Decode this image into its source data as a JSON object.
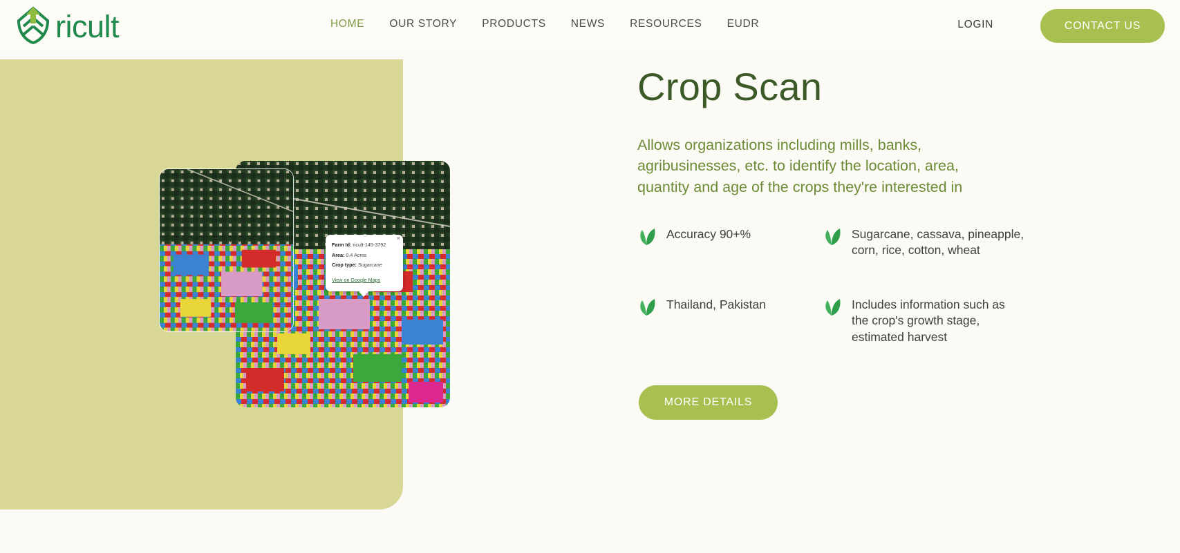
{
  "header": {
    "logo_text": "ricult",
    "nav_items": [
      {
        "label": "HOME",
        "active": true
      },
      {
        "label": "OUR STORY",
        "active": false
      },
      {
        "label": "PRODUCTS",
        "active": false
      },
      {
        "label": "NEWS",
        "active": false
      },
      {
        "label": "RESOURCES",
        "active": false
      },
      {
        "label": "EUDR",
        "active": false
      }
    ],
    "login_label": "LOGIN",
    "contact_label": "CONTACT US",
    "accent_color": "#a7c04f",
    "logo_color": "#1f8a4c",
    "active_nav_color": "#7d9a44"
  },
  "hero": {
    "title": "Crop Scan",
    "subtitle": "Allows organizations including mills, banks, agribusinesses, etc. to identify the location, area, quantity and age of the crops they're interested in",
    "title_color": "#3c5a27",
    "subtitle_color": "#6c8b35",
    "features": [
      {
        "icon": "leaf-icon",
        "text": "Accuracy 90+%"
      },
      {
        "icon": "leaf-icon",
        "text": "Sugarcane, cassava, pineapple, corn, rice, cotton, wheat"
      },
      {
        "icon": "leaf-icon",
        "text": "Thailand, Pakistan"
      },
      {
        "icon": "leaf-icon",
        "text": "Includes information such as the crop's growth stage, estimated harvest"
      }
    ],
    "cta_label": "MORE DETAILS"
  },
  "map": {
    "panel_color": "#d9d795",
    "popup": {
      "close_label": "×",
      "rows": [
        {
          "label": "Farm Id:",
          "value": "ricult-145-3792"
        },
        {
          "label": "Area:",
          "value": "0.4 Acres"
        },
        {
          "label": "Crop type:",
          "value": "Sugarcane"
        }
      ],
      "link_label": "View on Google Maps"
    }
  }
}
